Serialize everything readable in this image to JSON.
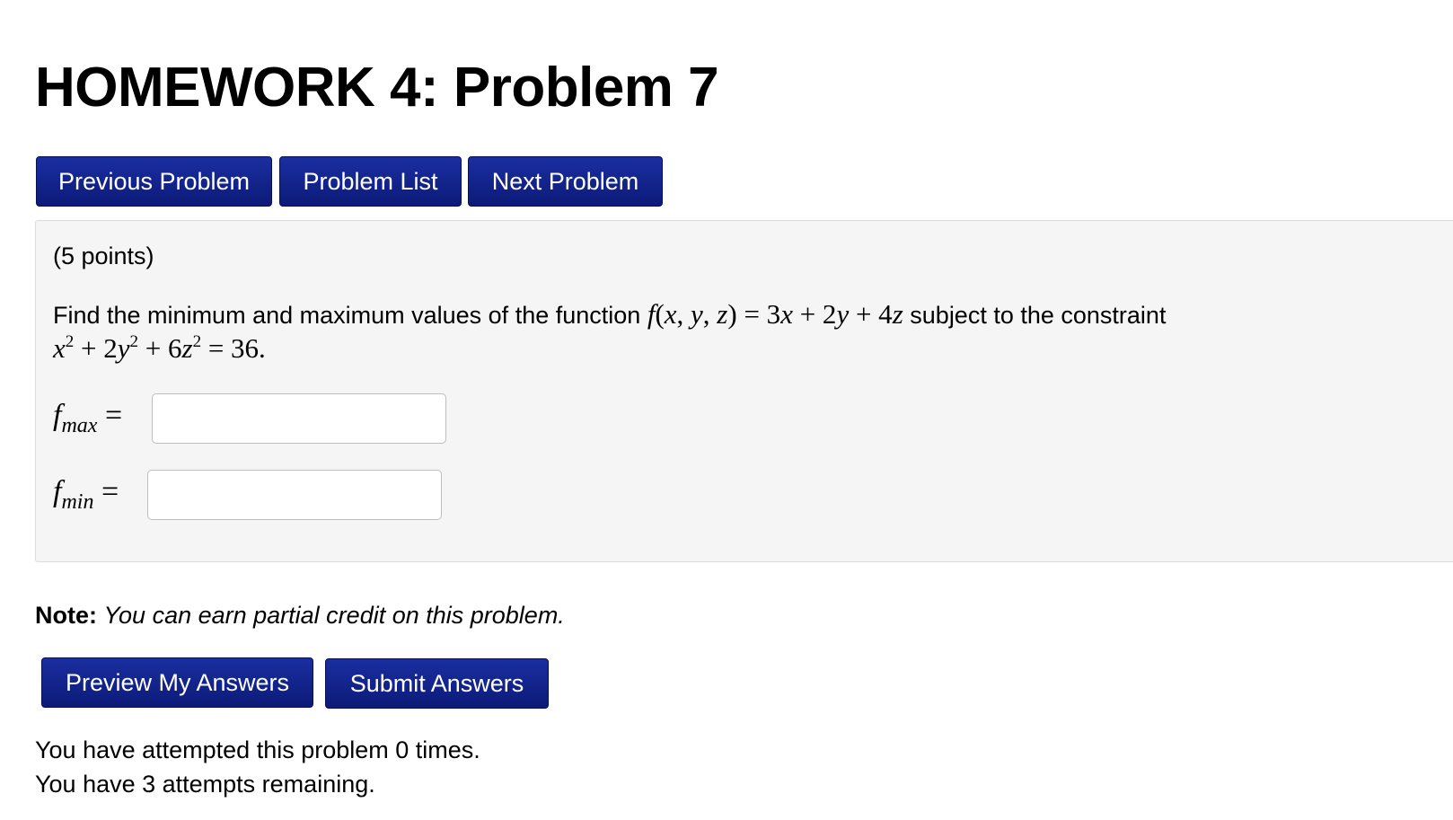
{
  "page_title": "HOMEWORK 4: Problem 7",
  "nav": {
    "previous_label": "Previous Problem",
    "list_label": "Problem List",
    "next_label": "Next Problem"
  },
  "problem": {
    "points": "(5 points)",
    "statement_prefix": "Find the minimum and maximum values of the function",
    "statement_suffix": "subject to the constraint",
    "function_expr": "f(x, y, z) = 3x + 2y + 4z",
    "constraint_expr": "x² + 2y² + 6z² = 36."
  },
  "answers": {
    "fmax_label": "f",
    "fmax_sub": "max",
    "fmax_value": "",
    "fmin_label": "f",
    "fmin_sub": "min",
    "fmin_value": "",
    "equals": "="
  },
  "note": {
    "label": "Note:",
    "text": "You can earn partial credit on this problem."
  },
  "actions": {
    "preview_label": "Preview My Answers",
    "submit_label": "Submit Answers"
  },
  "status": {
    "attempted": "You have attempted this problem 0 times.",
    "remaining": "You have 3 attempts remaining."
  },
  "colors": {
    "button_bg": "#0f1f88",
    "problem_bg": "#f5f5f5"
  }
}
